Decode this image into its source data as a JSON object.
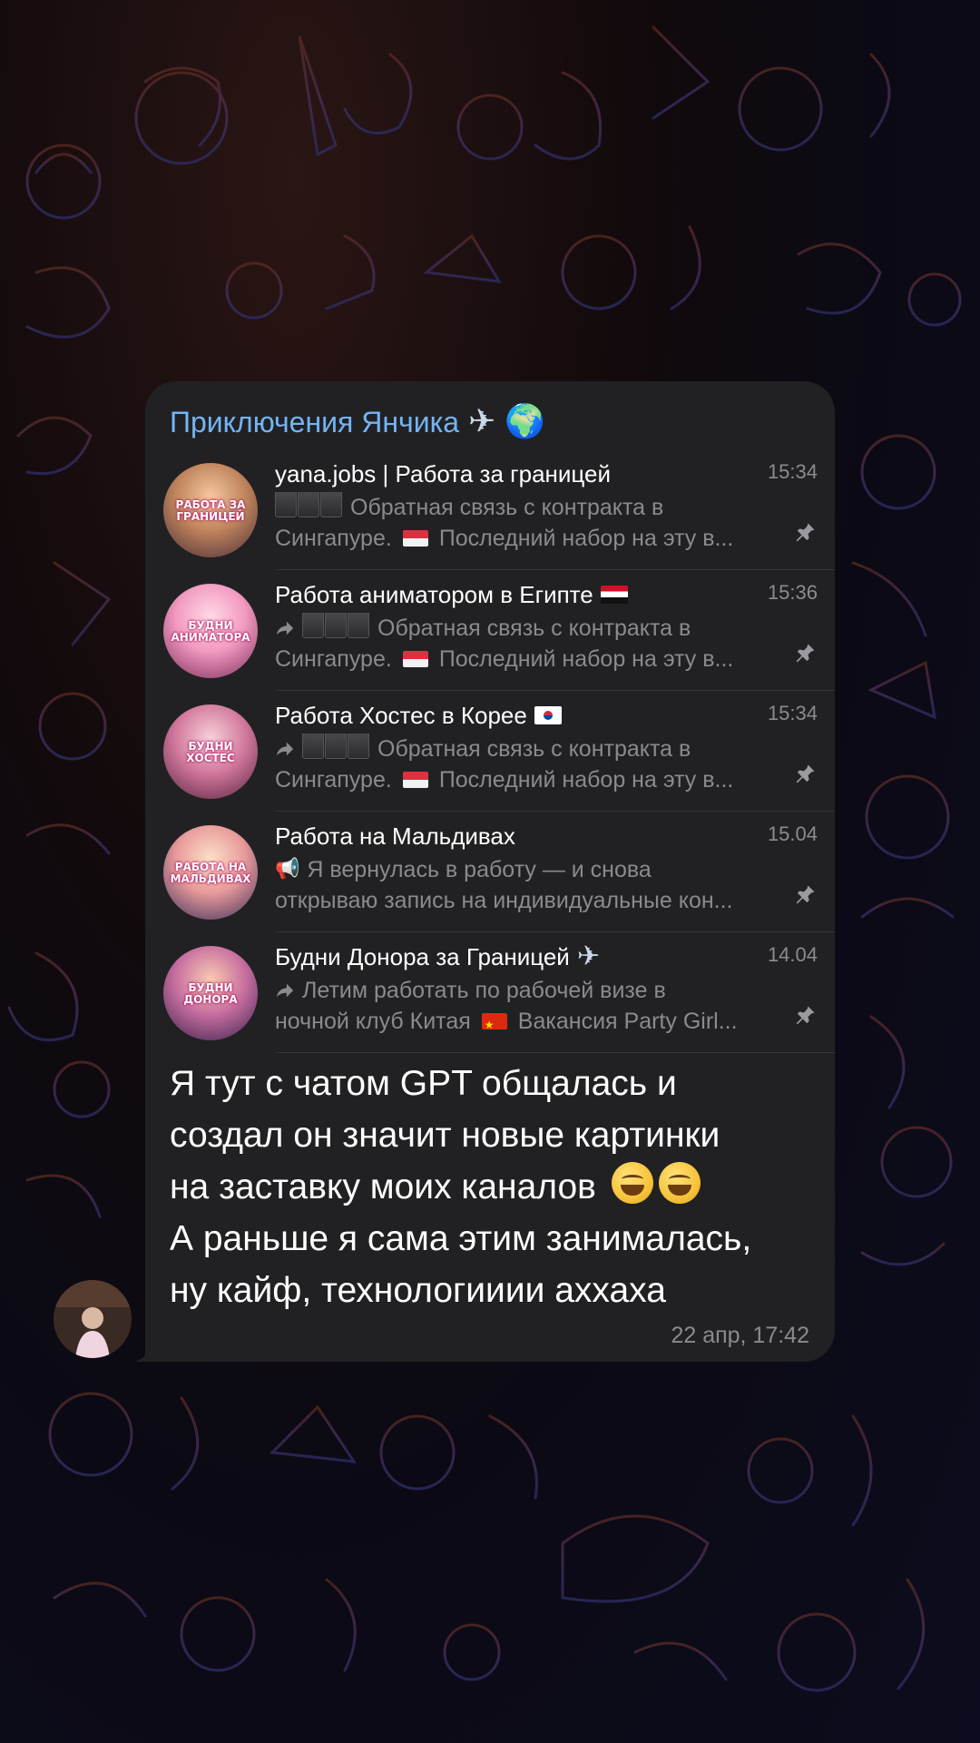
{
  "folder": {
    "title": "Приключения Янчика",
    "title_emojis": [
      "✈",
      "🌍"
    ]
  },
  "channels": [
    {
      "name": "yana.jobs | Работа за границей",
      "time": "15:34",
      "avatar_text": "РАБОТА ЗА ГРАНИЦЕЙ",
      "forwarded": false,
      "preview_line1": "Обратная связь с контракта в",
      "preview_line2_a": "Сингапуре.",
      "preview_line2_b": "Последний набор на эту в...",
      "pinned": true
    },
    {
      "name": "Работа аниматором в Египте",
      "time": "15:36",
      "avatar_text": "БУДНИ АНИМАТОРА",
      "forwarded": true,
      "preview_line1": "Обратная связь с контракта в",
      "preview_line2_a": "Сингапуре.",
      "preview_line2_b": "Последний набор на эту в...",
      "pinned": true
    },
    {
      "name": "Работа Хостес в Корее",
      "time": "15:34",
      "avatar_text": "БУДНИ ХОСТЕС",
      "forwarded": true,
      "preview_line1": "Обратная связь с контракта в",
      "preview_line2_a": "Сингапуре.",
      "preview_line2_b": "Последний набор на эту в...",
      "pinned": true
    },
    {
      "name": "Работа на Мальдивах",
      "time": "15.04",
      "avatar_text": "РАБОТА НА МАЛЬДИВАХ",
      "forwarded": false,
      "preview_line1": "Я вернулась в работу — и снова",
      "preview_line2": "открываю запись на индивидуальные кон...",
      "pinned": true
    },
    {
      "name": "Будни Донора за Границей",
      "time": "14.04",
      "avatar_text": "БУДНИ ДОНОРА",
      "forwarded": true,
      "preview_line1": "Летим работать по рабочей визе в",
      "preview_line2_a": "ночной клуб Китая",
      "preview_line2_b": "Вакансия Party Girl...",
      "pinned": true
    }
  ],
  "message": {
    "lines": [
      "Я тут с чатом GPT общалась и",
      "создал он значит новые картинки",
      "на заставку моих каналов",
      "А раньше я сама этим занималась,",
      "ну кайф, технологииии аххаха"
    ],
    "time": "22 апр, 17:42"
  },
  "colors": {
    "bubble": "#212123",
    "folder_title": "#74b4f3",
    "muted_text": "#8a8a8f"
  }
}
